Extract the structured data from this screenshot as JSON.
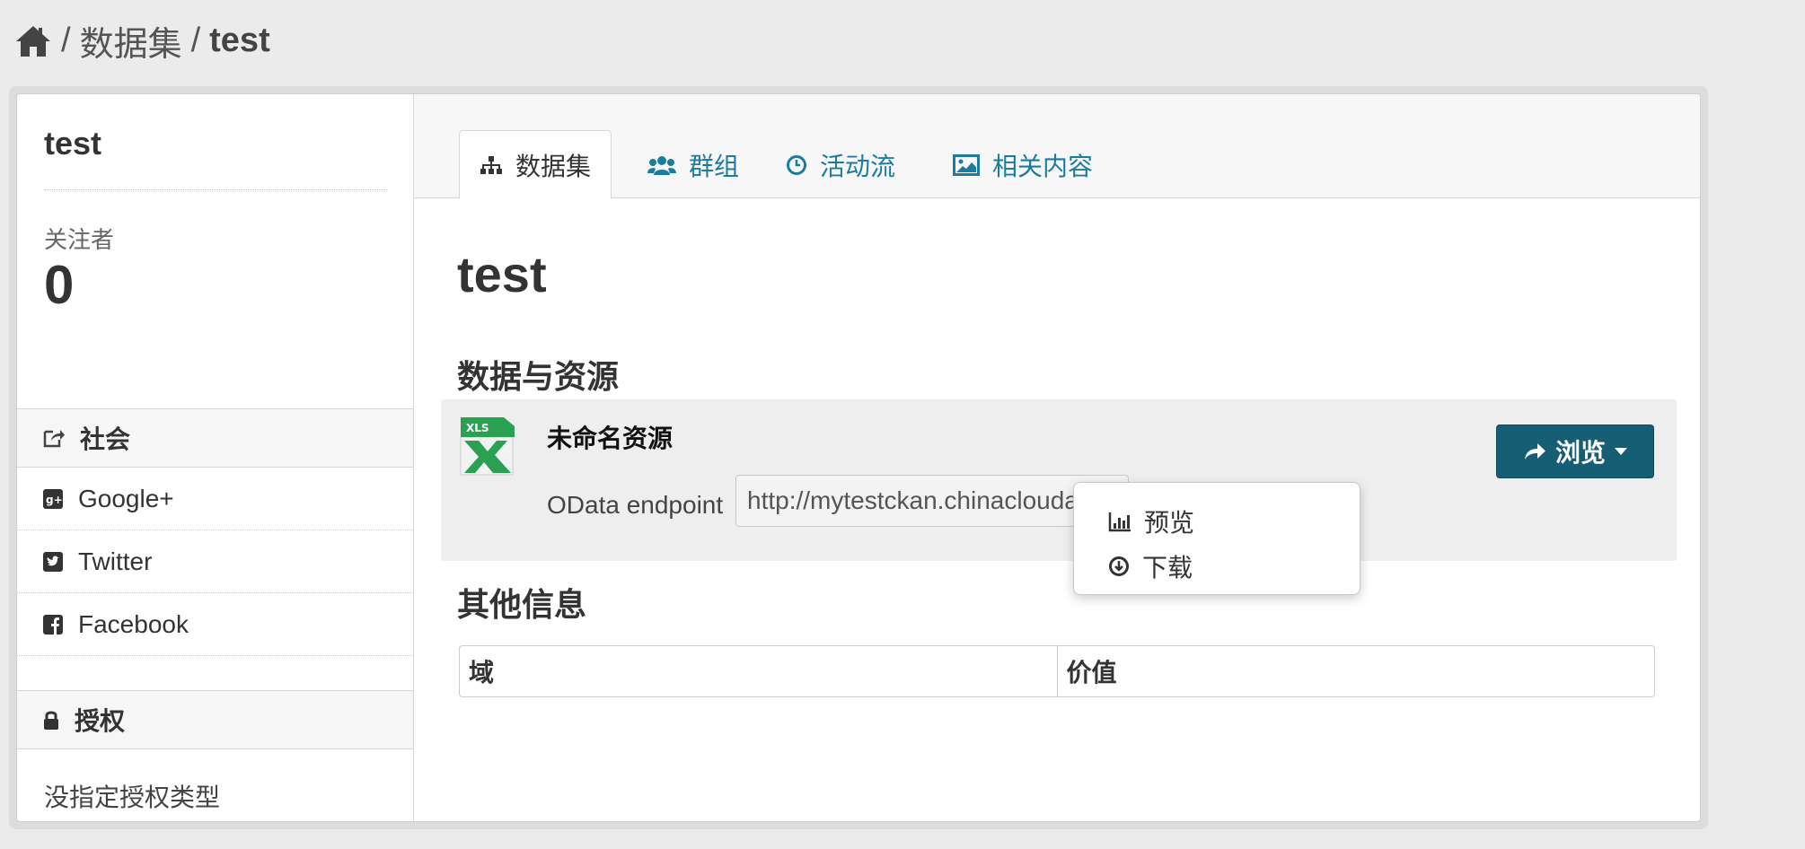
{
  "breadcrumb": {
    "home_icon": "home-icon",
    "items": [
      "数据集",
      "test"
    ],
    "separator": "/"
  },
  "sidebar": {
    "title": "test",
    "followers_label": "关注者",
    "followers_count": "0",
    "social": {
      "heading": "社会",
      "heading_icon": "share-icon",
      "items": [
        {
          "label": "Google+",
          "icon": "google-plus-icon"
        },
        {
          "label": "Twitter",
          "icon": "twitter-icon"
        },
        {
          "label": "Facebook",
          "icon": "facebook-icon"
        }
      ]
    },
    "license": {
      "heading": "授权",
      "heading_icon": "lock-icon",
      "text": "没指定授权类型"
    }
  },
  "tabs": [
    {
      "label": "数据集",
      "icon": "sitemap-icon",
      "active": true
    },
    {
      "label": "群组",
      "icon": "users-icon",
      "active": false
    },
    {
      "label": "活动流",
      "icon": "clock-icon",
      "active": false
    },
    {
      "label": "相关内容",
      "icon": "picture-icon",
      "active": false
    }
  ],
  "main": {
    "title": "test",
    "resources_heading": "数据与资源",
    "resource": {
      "title": "未命名资源",
      "format_label": "OData endpoint",
      "url": "http://mytestckan.chinacloudapp.",
      "icon": "xls-file-icon"
    },
    "explore_button": {
      "label": "浏览",
      "icon": "share-arrow-icon"
    },
    "dropdown": [
      {
        "label": "预览",
        "icon": "bar-chart-icon"
      },
      {
        "label": "下载",
        "icon": "download-circle-icon"
      }
    ],
    "other_heading": "其他信息",
    "table_headers": [
      "域",
      "价值"
    ]
  },
  "colors": {
    "link": "#1c7ca0",
    "button": "#155e74",
    "background": "#ebebeb"
  }
}
